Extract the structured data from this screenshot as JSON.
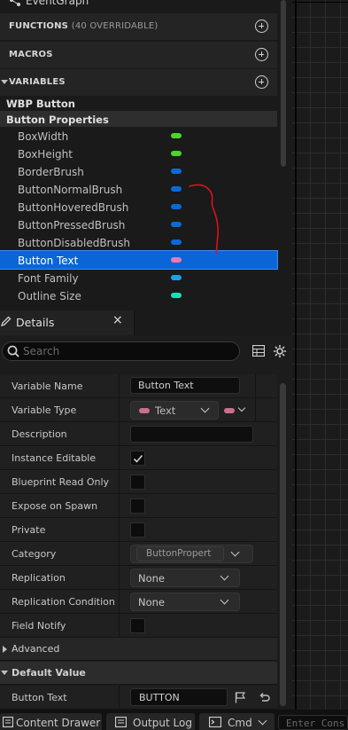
{
  "my_blueprint": {
    "eventgraph_label": "EventGraph",
    "functions": {
      "label": "FUNCTIONS",
      "sub": "(40 OVERRIDABLE)"
    },
    "macros": {
      "label": "MACROS"
    },
    "variables": {
      "label": "VARIABLES"
    },
    "tree": {
      "root": "WBP Button",
      "category": "Button Properties",
      "items": [
        {
          "name": "BoxWidth",
          "pin_color": "#4ed32a"
        },
        {
          "name": "BoxHeight",
          "pin_color": "#4ed32a"
        },
        {
          "name": "BorderBrush",
          "pin_color": "#0a6ad6"
        },
        {
          "name": "ButtonNormalBrush",
          "pin_color": "#0a6ad6"
        },
        {
          "name": "ButtonHoveredBrush",
          "pin_color": "#0a6ad6"
        },
        {
          "name": "ButtonPressedBrush",
          "pin_color": "#0a6ad6"
        },
        {
          "name": "ButtonDisabledBrush",
          "pin_color": "#0a6ad6"
        },
        {
          "name": "Button Text",
          "pin_color": "#e87ab4",
          "selected": true
        },
        {
          "name": "Font Family",
          "pin_color": "#1aa3e8"
        },
        {
          "name": "Outline Size",
          "pin_color": "#1ee0b4"
        }
      ]
    }
  },
  "details": {
    "tab_label": "Details",
    "close_glyph": "×",
    "search_placeholder": "Search",
    "rows": {
      "variable_name": {
        "label": "Variable Name",
        "value": "Button Text"
      },
      "variable_type": {
        "label": "Variable Type",
        "value": "Text",
        "type_color": "#c96f8e"
      },
      "description": {
        "label": "Description",
        "value": ""
      },
      "instance_editable": {
        "label": "Instance Editable",
        "checked": true
      },
      "blueprint_read_only": {
        "label": "Blueprint Read Only",
        "checked": false
      },
      "expose_on_spawn": {
        "label": "Expose on Spawn",
        "checked": false
      },
      "private": {
        "label": "Private",
        "checked": false
      },
      "category": {
        "label": "Category",
        "value": "ButtonPropert"
      },
      "replication": {
        "label": "Replication",
        "value": "None"
      },
      "replication_condition": {
        "label": "Replication Condition",
        "value": "None"
      },
      "field_notify": {
        "label": "Field Notify",
        "checked": false
      }
    },
    "advanced_label": "Advanced",
    "default_value_label": "Default Value",
    "default_button_text": {
      "label": "Button Text",
      "value": "BUTTON"
    }
  },
  "bottom_bar": {
    "content_drawer": "Content Drawer",
    "output_log": "Output Log",
    "cmd": "Cmd",
    "console_placeholder": "Enter Cons"
  },
  "annotation_color": "#e0101a",
  "accent_color": "#0a66d6"
}
